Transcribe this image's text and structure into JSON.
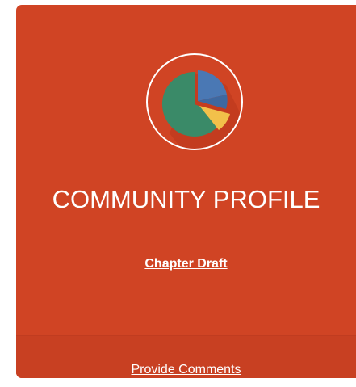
{
  "card": {
    "title": "COMMUNITY PROFILE",
    "draft_link": "Chapter Draft",
    "comments_link": "Provide Comments",
    "icon": "pie-chart-icon",
    "colors": {
      "background": "#d04424",
      "footer": "#c84022",
      "pie_green": "#3a8a68",
      "pie_blue": "#4a78b4",
      "pie_yellow": "#f2c04a"
    }
  }
}
